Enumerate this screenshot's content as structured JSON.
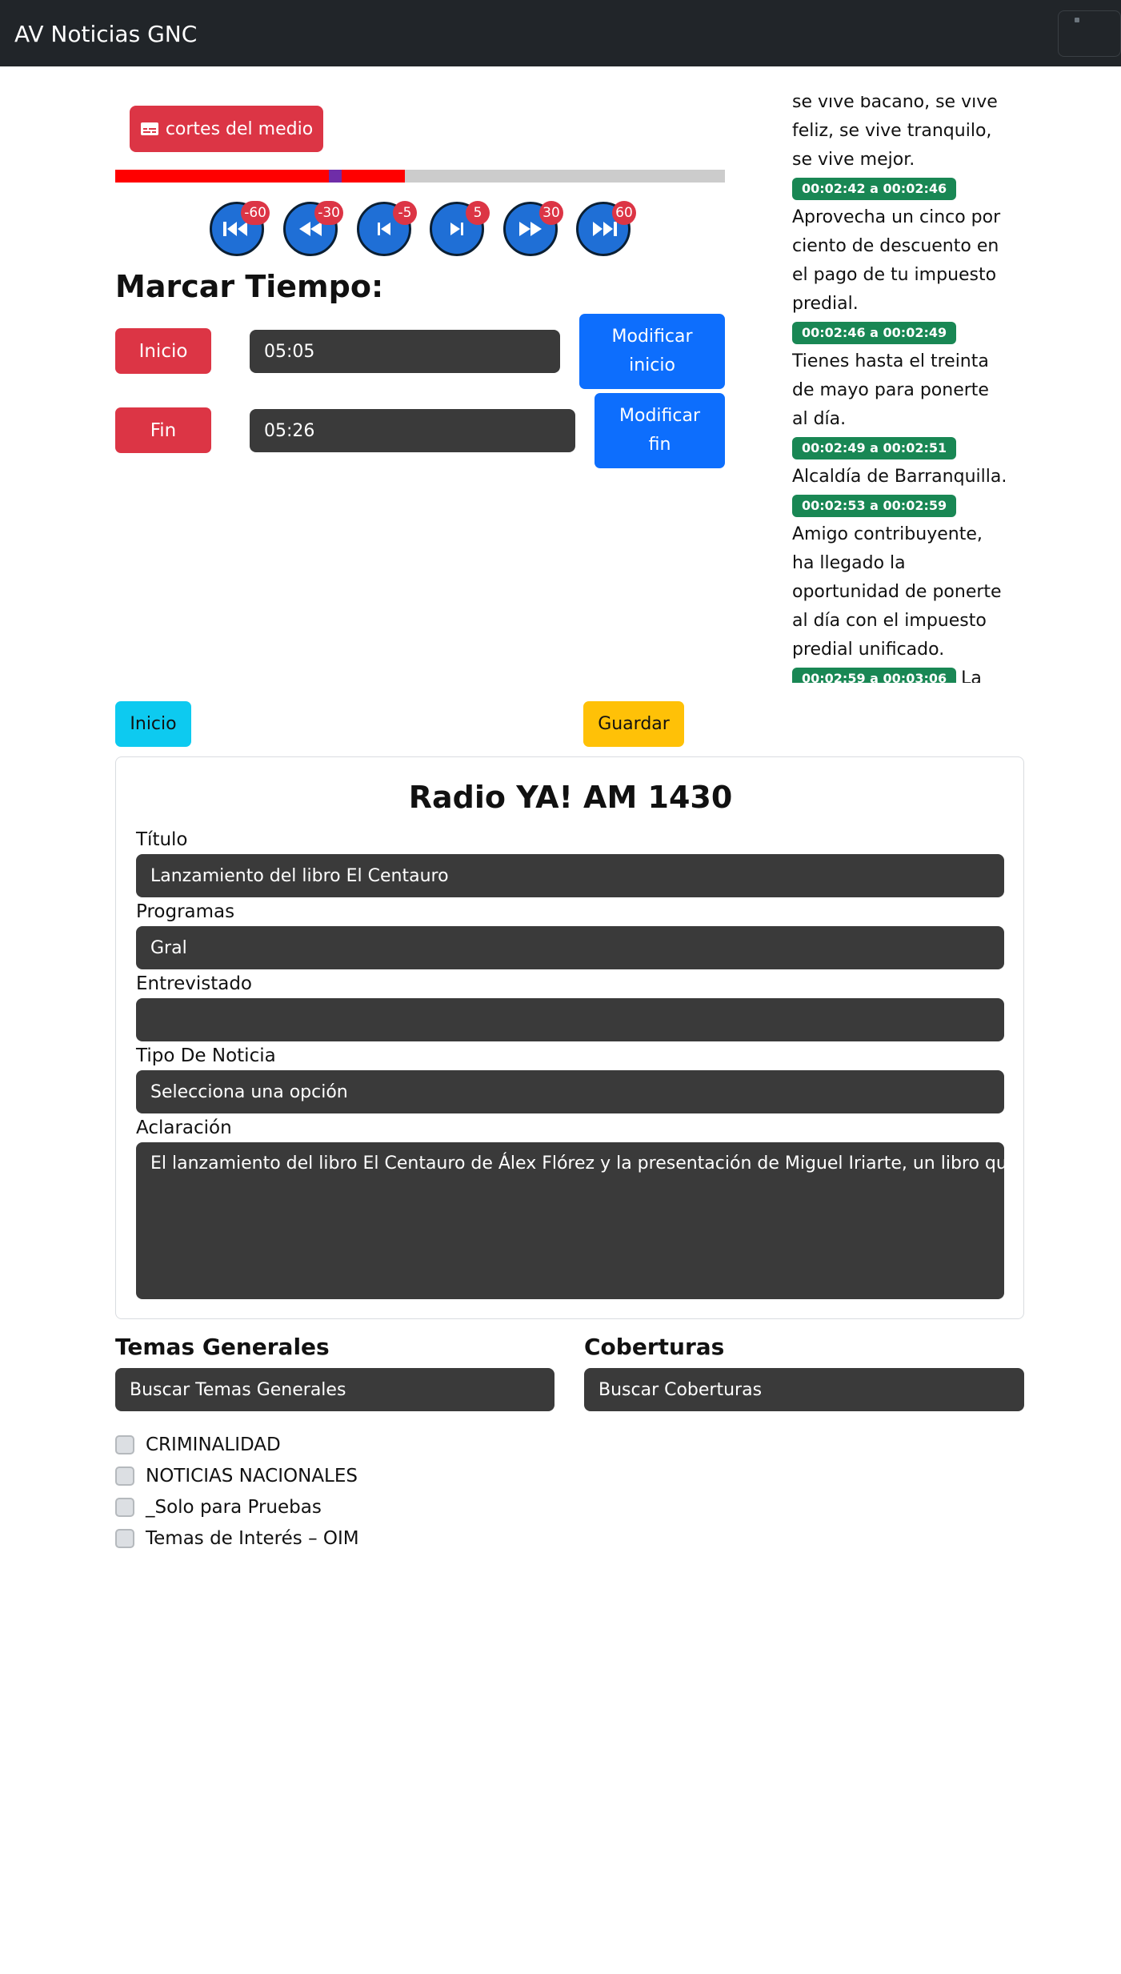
{
  "navbar": {
    "brand": "AV Noticias GNC"
  },
  "player": {
    "cortes_label": "cortes del medio",
    "progress_fraction": 0.475,
    "progress_marker_fraction": 0.35,
    "controls": [
      {
        "icon": "skip-to-start-icon",
        "badge": "-60"
      },
      {
        "icon": "rewind-icon",
        "badge": "-30"
      },
      {
        "icon": "step-back-icon",
        "badge": "-5"
      },
      {
        "icon": "step-forward-icon",
        "badge": "5"
      },
      {
        "icon": "fast-forward-icon",
        "badge": "30"
      },
      {
        "icon": "skip-to-end-icon",
        "badge": "60"
      }
    ]
  },
  "marcar": {
    "title": "Marcar Tiempo:",
    "inicio_label": "Inicio",
    "inicio_value": "05:05",
    "modificar_inicio_1": "Modificar",
    "modificar_inicio_2": "inicio",
    "fin_label": "Fin",
    "fin_value": "05:26",
    "modificar_fin_1": "Modificar",
    "modificar_fin_2": "fin"
  },
  "transcript": {
    "lead": "se vive bacano, se vive feliz, se vive tranquilo, se vive mejor.",
    "entries": [
      {
        "time": "00:02:42 a 00:02:46",
        "text": "Aprovecha un cinco por ciento de descuento en el pago de tu impuesto predial."
      },
      {
        "time": "00:02:46 a 00:02:49",
        "text": "Tienes hasta el treinta de mayo para ponerte al día."
      },
      {
        "time": "00:02:49 a 00:02:51",
        "text": "Alcaldía de Barranquilla."
      },
      {
        "time": "00:02:53 a 00:02:59",
        "text": "Amigo contribuyente, ha llegado la oportunidad de ponerte al día con el impuesto predial unificado."
      },
      {
        "time": "00:02:59 a 00:03:06",
        "text": "La Alcaldía Municipal de"
      }
    ]
  },
  "actions": {
    "inicio": "Inicio",
    "guardar": "Guardar"
  },
  "form": {
    "station": "Radio YA! AM 1430",
    "titulo_label": "Título",
    "titulo_value": "Lanzamiento del libro El Centauro",
    "programas_label": "Programas",
    "programas_value": "Gral",
    "entrevistado_label": "Entrevistado",
    "entrevistado_value": "",
    "tipo_label": "Tipo De Noticia",
    "tipo_value": "Selecciona una opción",
    "aclaracion_label": "Aclaración",
    "aclaracion_value": "El lanzamiento del libro El Centauro de Álex Flórez y la presentación de Miguel Iriarte, un libro que tra"
  },
  "temas": {
    "title": "Temas Generales",
    "search_placeholder": "Buscar Temas Generales",
    "items": [
      "CRIMINALIDAD",
      "NOTICIAS NACIONALES",
      "_Solo para Pruebas",
      "Temas de Interés – OIM"
    ]
  },
  "coberturas": {
    "title": "Coberturas",
    "search_placeholder": "Buscar Coberturas"
  }
}
